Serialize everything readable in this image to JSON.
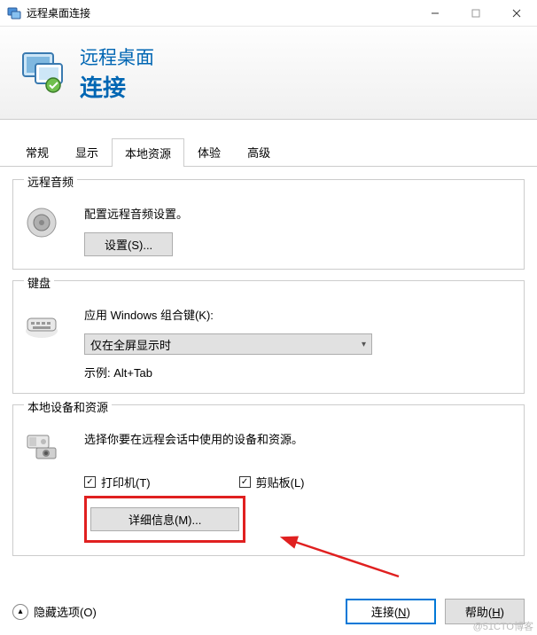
{
  "window": {
    "title": "远程桌面连接"
  },
  "header": {
    "line1": "远程桌面",
    "line2": "连接"
  },
  "tabs": [
    {
      "label": "常规"
    },
    {
      "label": "显示"
    },
    {
      "label": "本地资源",
      "active": true
    },
    {
      "label": "体验"
    },
    {
      "label": "高级"
    }
  ],
  "audio": {
    "legend": "远程音频",
    "desc": "配置远程音频设置。",
    "settings_btn": "设置(S)..."
  },
  "keyboard": {
    "legend": "键盘",
    "label": "应用 Windows 组合键(K):",
    "combo_value": "仅在全屏显示时",
    "example": "示例: Alt+Tab"
  },
  "local": {
    "legend": "本地设备和资源",
    "desc": "选择你要在远程会话中使用的设备和资源。",
    "printer_label": "打印机(T)",
    "clipboard_label": "剪贴板(L)",
    "details_btn": "详细信息(M)..."
  },
  "bottom": {
    "hide_options": "隐藏选项(O)",
    "connect": "连接",
    "connect_key": "N",
    "help": "帮助",
    "help_key": "H"
  },
  "watermark": "@51CTO博客"
}
